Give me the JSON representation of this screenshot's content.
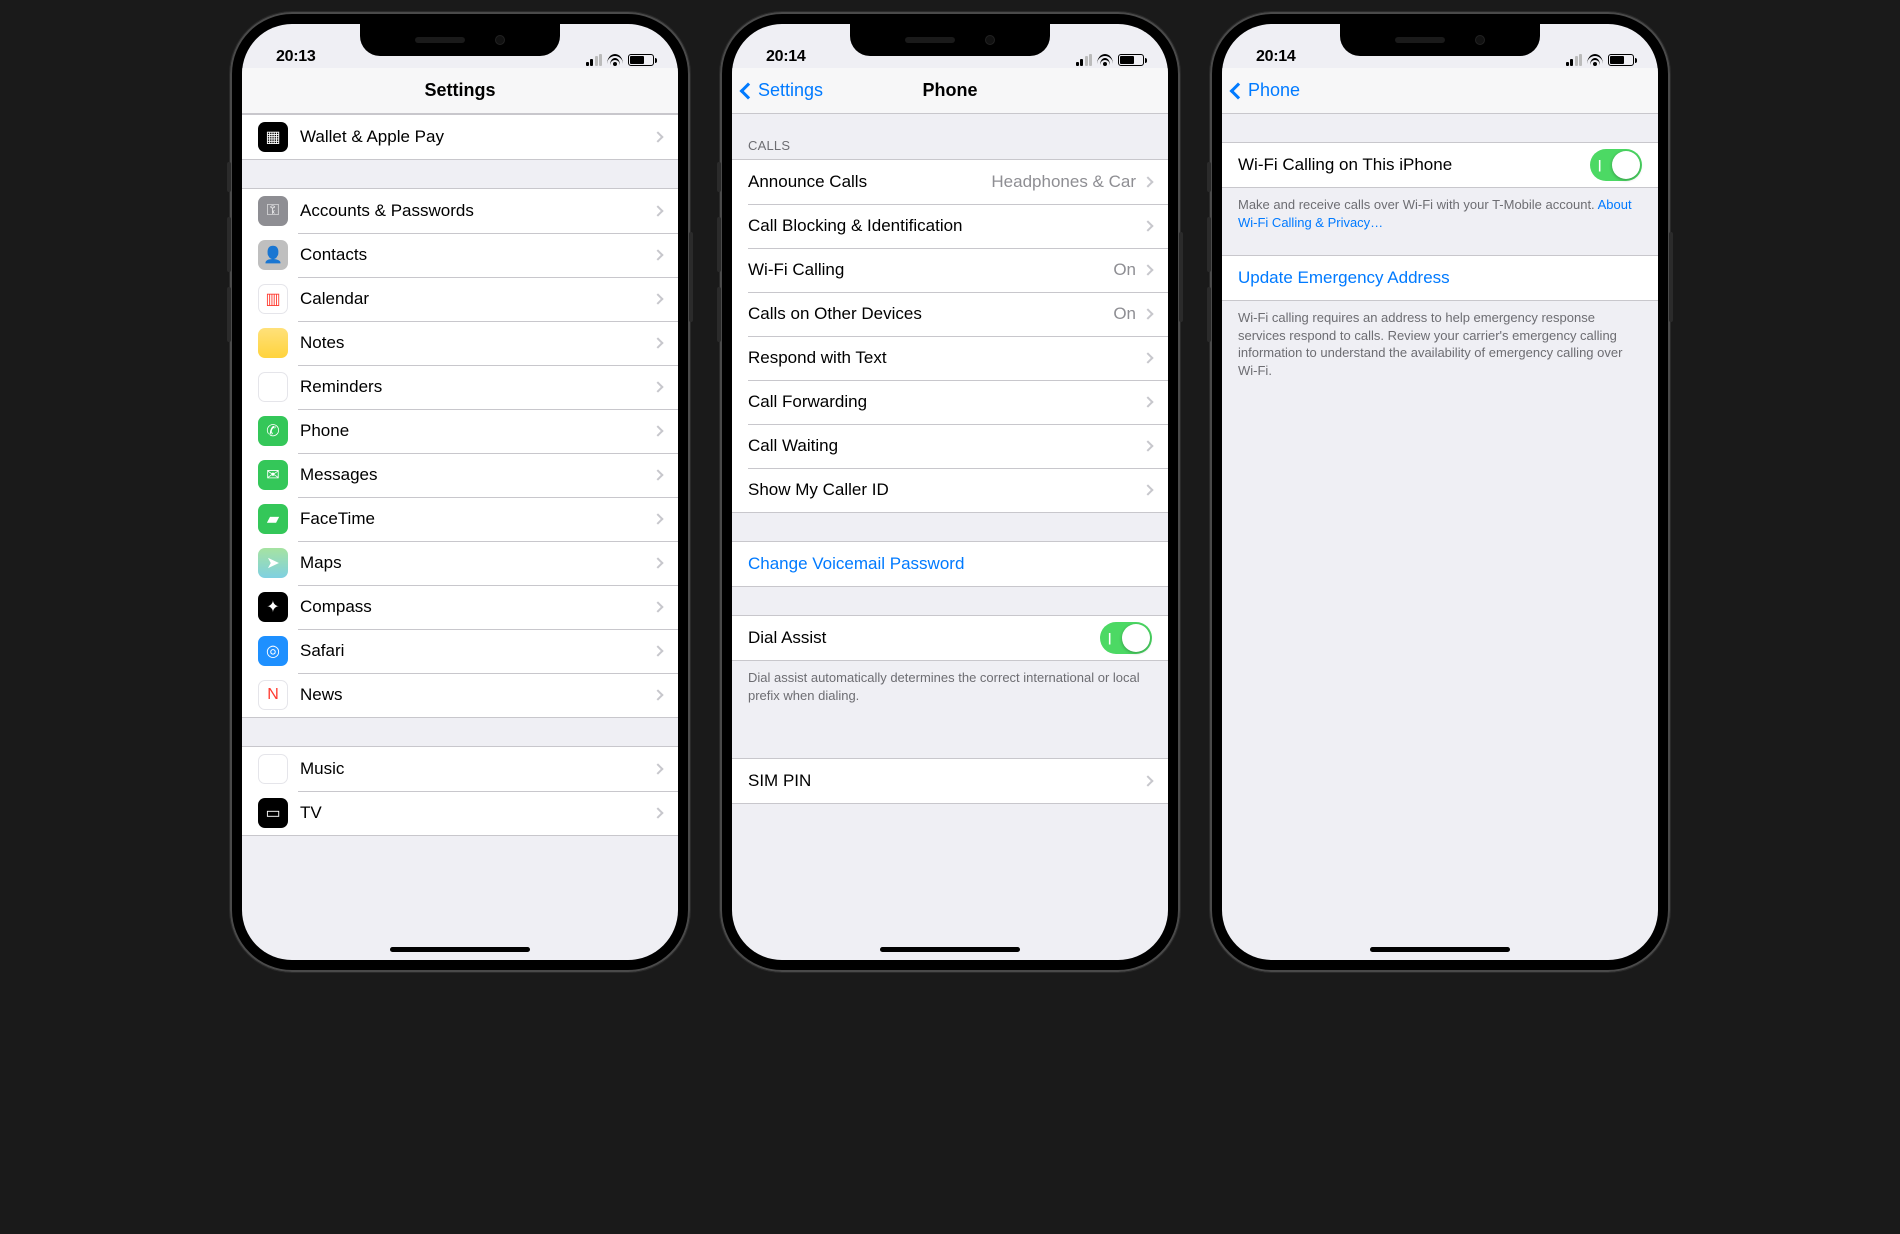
{
  "screen1": {
    "time": "20:13",
    "title": "Settings",
    "groups": [
      {
        "items": [
          {
            "id": "wallet",
            "label": "Wallet & Apple Pay",
            "iconClass": "ic-wallet",
            "glyph": "▦"
          }
        ]
      },
      {
        "items": [
          {
            "id": "accounts",
            "label": "Accounts & Passwords",
            "iconClass": "ic-keys",
            "glyph": "⚿"
          },
          {
            "id": "contacts",
            "label": "Contacts",
            "iconClass": "ic-contacts",
            "glyph": "👤"
          },
          {
            "id": "calendar",
            "label": "Calendar",
            "iconClass": "ic-calendar",
            "glyph": "▥"
          },
          {
            "id": "notes",
            "label": "Notes",
            "iconClass": "ic-notes",
            "glyph": ""
          },
          {
            "id": "reminders",
            "label": "Reminders",
            "iconClass": "ic-reminders",
            "glyph": "⋮"
          },
          {
            "id": "phone",
            "label": "Phone",
            "iconClass": "ic-phone",
            "glyph": "✆"
          },
          {
            "id": "messages",
            "label": "Messages",
            "iconClass": "ic-messages",
            "glyph": "✉"
          },
          {
            "id": "facetime",
            "label": "FaceTime",
            "iconClass": "ic-facetime",
            "glyph": "▰"
          },
          {
            "id": "maps",
            "label": "Maps",
            "iconClass": "ic-maps",
            "glyph": "➤"
          },
          {
            "id": "compass",
            "label": "Compass",
            "iconClass": "ic-compass",
            "glyph": "✦"
          },
          {
            "id": "safari",
            "label": "Safari",
            "iconClass": "ic-safari",
            "glyph": "◎"
          },
          {
            "id": "news",
            "label": "News",
            "iconClass": "ic-news",
            "glyph": "N"
          }
        ]
      },
      {
        "items": [
          {
            "id": "music",
            "label": "Music",
            "iconClass": "ic-music",
            "glyph": "♫"
          },
          {
            "id": "tv",
            "label": "TV",
            "iconClass": "ic-tv",
            "glyph": "▭"
          }
        ]
      }
    ]
  },
  "screen2": {
    "time": "20:14",
    "back": "Settings",
    "title": "Phone",
    "callsHeader": "CALLS",
    "calls": [
      {
        "id": "announce",
        "label": "Announce Calls",
        "value": "Headphones & Car"
      },
      {
        "id": "blocking",
        "label": "Call Blocking & Identification",
        "value": ""
      },
      {
        "id": "wificalling",
        "label": "Wi-Fi Calling",
        "value": "On"
      },
      {
        "id": "otherdevices",
        "label": "Calls on Other Devices",
        "value": "On"
      },
      {
        "id": "respondtext",
        "label": "Respond with Text",
        "value": ""
      },
      {
        "id": "forwarding",
        "label": "Call Forwarding",
        "value": ""
      },
      {
        "id": "waiting",
        "label": "Call Waiting",
        "value": ""
      },
      {
        "id": "callerid",
        "label": "Show My Caller ID",
        "value": ""
      }
    ],
    "voicemail": {
      "label": "Change Voicemail Password"
    },
    "dialAssist": {
      "label": "Dial Assist",
      "on": true
    },
    "dialAssistFooter": "Dial assist automatically determines the correct international or local prefix when dialing.",
    "simPin": {
      "label": "SIM PIN"
    }
  },
  "screen3": {
    "time": "20:14",
    "back": "Phone",
    "wifiToggle": {
      "label": "Wi-Fi Calling on This iPhone",
      "on": true
    },
    "wifiFooter": "Make and receive calls over Wi-Fi with your T-Mobile account. ",
    "wifiFooterLink": "About Wi-Fi Calling & Privacy…",
    "emergency": {
      "label": "Update Emergency Address"
    },
    "emergencyFooter": "Wi-Fi calling requires an address to help emergency response services respond to calls. Review your carrier's emergency calling information to understand the availability of emergency calling over Wi-Fi."
  }
}
